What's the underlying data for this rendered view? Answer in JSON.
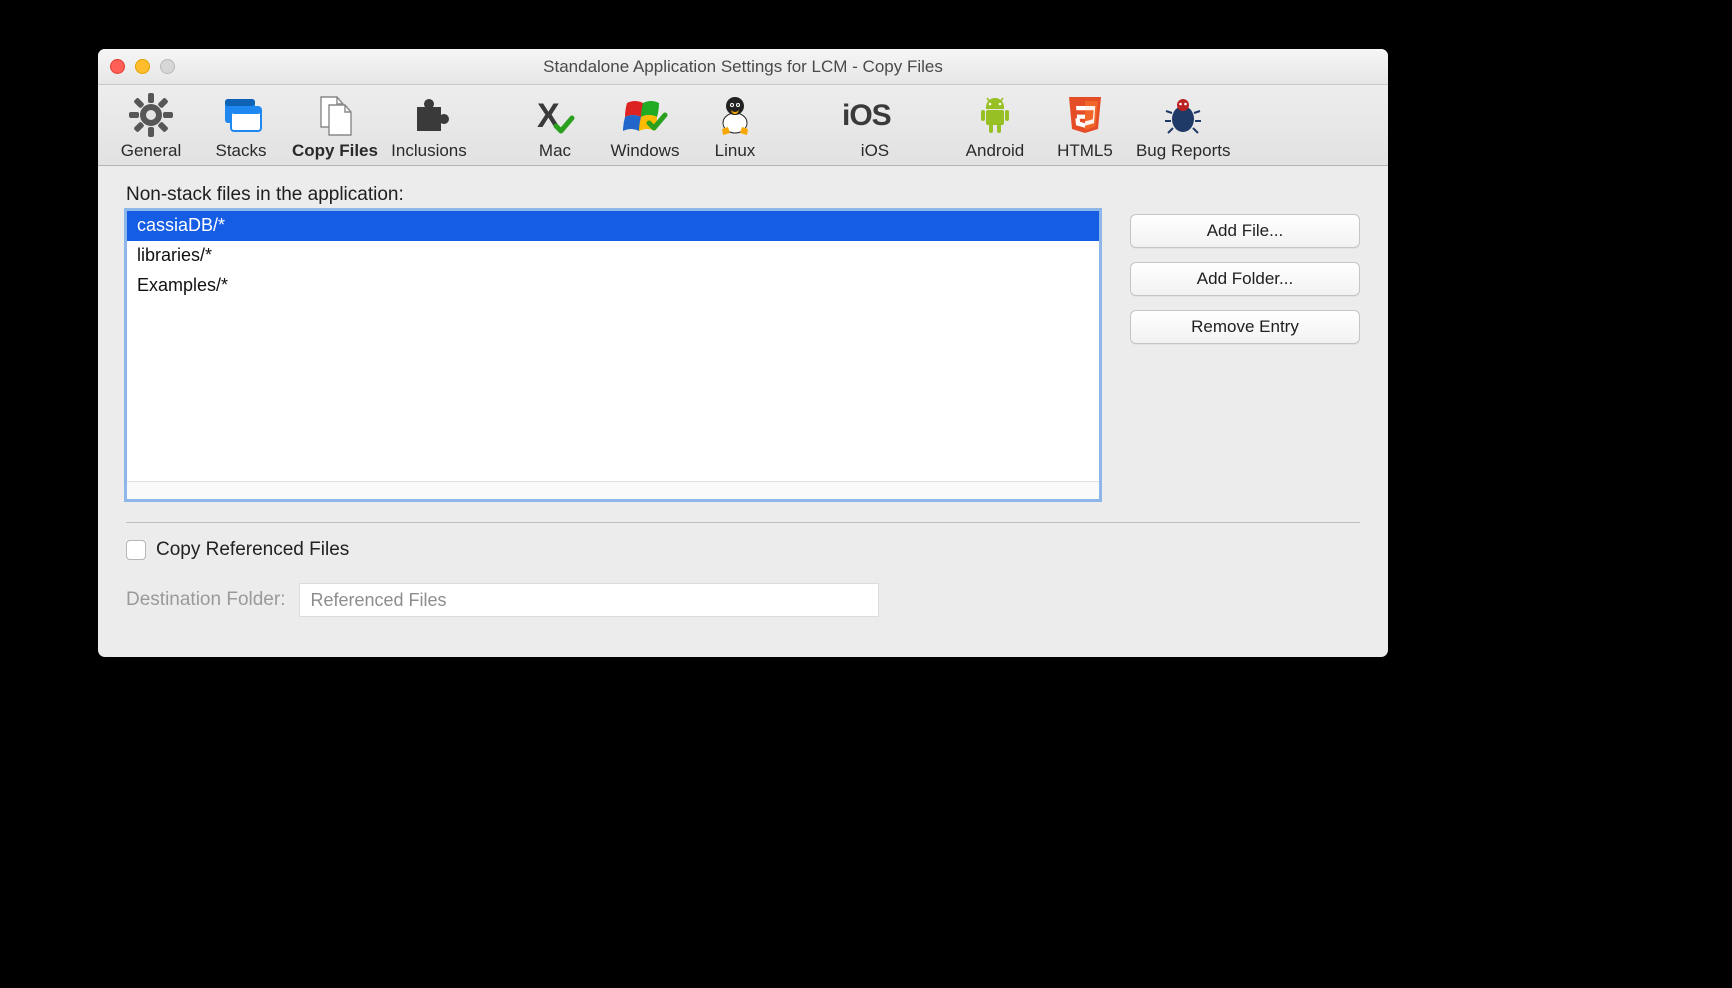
{
  "window": {
    "title": "Standalone Application Settings for LCM - Copy Files"
  },
  "toolbar": {
    "items": [
      {
        "id": "general",
        "label": "General"
      },
      {
        "id": "stacks",
        "label": "Stacks"
      },
      {
        "id": "copyfiles",
        "label": "Copy Files",
        "active": true
      },
      {
        "id": "inclusions",
        "label": "Inclusions"
      },
      {
        "id": "mac",
        "label": "Mac"
      },
      {
        "id": "windows",
        "label": "Windows"
      },
      {
        "id": "linux",
        "label": "Linux"
      },
      {
        "id": "ios",
        "label": "iOS"
      },
      {
        "id": "android",
        "label": "Android"
      },
      {
        "id": "html5",
        "label": "HTML5"
      },
      {
        "id": "bugreports",
        "label": "Bug Reports"
      }
    ]
  },
  "content": {
    "nonstack_label": "Non-stack files in the application:",
    "file_list": [
      {
        "text": "cassiaDB/*",
        "selected": true
      },
      {
        "text": "libraries/*",
        "selected": false
      },
      {
        "text": "Examples/*",
        "selected": false
      }
    ],
    "buttons": {
      "add_file": "Add File...",
      "add_folder": "Add Folder...",
      "remove": "Remove Entry"
    },
    "copy_refs_checkbox_label": "Copy Referenced Files",
    "copy_refs_checked": false,
    "destination_label": "Destination Folder:",
    "destination_value": "Referenced Files"
  }
}
